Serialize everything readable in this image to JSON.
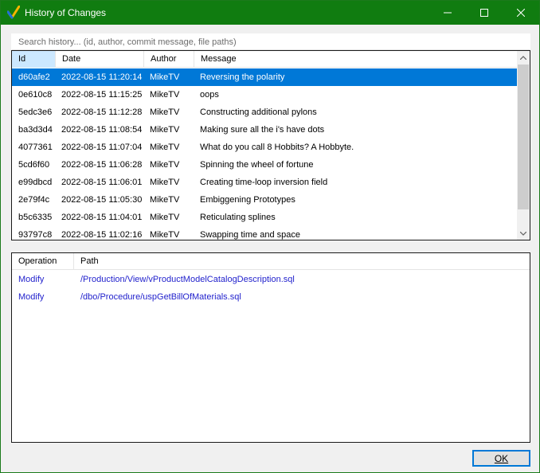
{
  "window": {
    "title": "History of Changes",
    "icon": "checkmark-logo-icon",
    "accent_color": "#107c10"
  },
  "search": {
    "placeholder": "Search history... (id, author, commit message, file paths)"
  },
  "history": {
    "columns": [
      "Id",
      "Date",
      "Author",
      "Message"
    ],
    "selected_index": 0,
    "rows": [
      {
        "id": "d60afe2",
        "date": "2022-08-15 11:20:14",
        "author": "MikeTV",
        "message": "Reversing the polarity"
      },
      {
        "id": "0e610c8",
        "date": "2022-08-15 11:15:25",
        "author": "MikeTV",
        "message": "oops"
      },
      {
        "id": "5edc3e6",
        "date": "2022-08-15 11:12:28",
        "author": "MikeTV",
        "message": "Constructing additional pylons"
      },
      {
        "id": "ba3d3d4",
        "date": "2022-08-15 11:08:54",
        "author": "MikeTV",
        "message": "Making sure all the i's have dots"
      },
      {
        "id": "4077361",
        "date": "2022-08-15 11:07:04",
        "author": "MikeTV",
        "message": "What do you call 8 Hobbits? A Hobbyte."
      },
      {
        "id": "5cd6f60",
        "date": "2022-08-15 11:06:28",
        "author": "MikeTV",
        "message": "Spinning the wheel of fortune"
      },
      {
        "id": "e99dbcd",
        "date": "2022-08-15 11:06:01",
        "author": "MikeTV",
        "message": "Creating time-loop inversion field"
      },
      {
        "id": "2e79f4c",
        "date": "2022-08-15 11:05:30",
        "author": "MikeTV",
        "message": "Embiggening Prototypes"
      },
      {
        "id": "b5c6335",
        "date": "2022-08-15 11:04:01",
        "author": "MikeTV",
        "message": "Reticulating splines"
      },
      {
        "id": "93797c8",
        "date": "2022-08-15 11:02:16",
        "author": "MikeTV",
        "message": "Swapping time and space"
      }
    ]
  },
  "operations": {
    "columns": [
      "Operation",
      "Path"
    ],
    "rows": [
      {
        "operation": "Modify",
        "path": "/Production/View/vProductModelCatalogDescription.sql"
      },
      {
        "operation": "Modify",
        "path": "/dbo/Procedure/uspGetBillOfMaterials.sql"
      }
    ]
  },
  "footer": {
    "ok_label": "OK"
  }
}
